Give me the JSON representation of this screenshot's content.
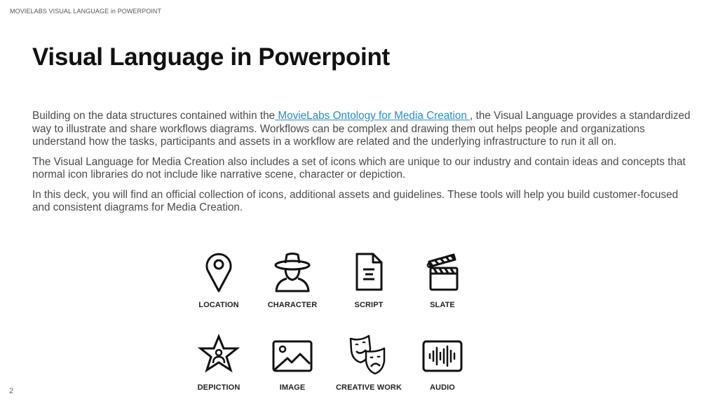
{
  "header": {
    "label": "MOVIELABS VISUAL LANGUAGE in POWERPOINT"
  },
  "title": "Visual Language in Powerpoint",
  "body": {
    "p1_before": "Building on the data structures contained within the",
    "p1_link": " MovieLabs Ontology for Media Creation ",
    "p1_after": ", the Visual Language provides a standardized way to illustrate and share workflows diagrams. Workflows can be complex and drawing them out helps people and organizations understand how the tasks, participants and assets in a workflow are related and the underlying infrastructure to run it all on.",
    "p2": "The Visual Language for Media Creation also includes a set of icons which are unique to our industry and contain ideas and concepts that normal icon libraries do not include like narrative scene, character or depiction.",
    "p3": "In this deck, you will find an official collection of icons, additional assets and guidelines. These tools will help you build customer-focused and consistent diagrams for Media Creation."
  },
  "icons": [
    {
      "name": "location-icon",
      "label": "LOCATION"
    },
    {
      "name": "character-icon",
      "label": "CHARACTER"
    },
    {
      "name": "script-icon",
      "label": "SCRIPT"
    },
    {
      "name": "slate-icon",
      "label": "SLATE"
    },
    {
      "name": "depiction-icon",
      "label": "DEPICTION"
    },
    {
      "name": "image-icon",
      "label": "IMAGE"
    },
    {
      "name": "creative-work-icon",
      "label": "CREATIVE WORK"
    },
    {
      "name": "audio-icon",
      "label": "AUDIO"
    }
  ],
  "page_number": "2"
}
